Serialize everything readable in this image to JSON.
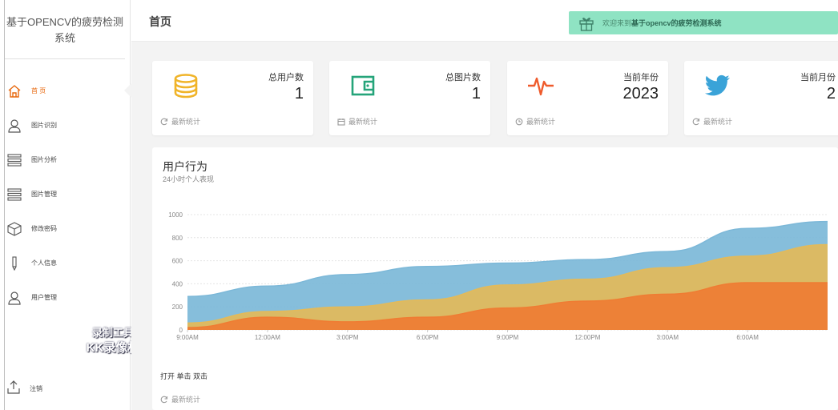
{
  "app": {
    "title": "基于OPENCV的疲劳检测系统"
  },
  "sidebar": {
    "items": [
      {
        "label": "首 页",
        "icon": "home-icon",
        "active": true
      },
      {
        "label": "图片识别",
        "icon": "user-icon"
      },
      {
        "label": "图片分析",
        "icon": "list-icon"
      },
      {
        "label": "图片管理",
        "icon": "list-icon"
      },
      {
        "label": "修改密码",
        "icon": "cube-icon"
      },
      {
        "label": "个人信息",
        "icon": "pen-icon"
      },
      {
        "label": "用户管理",
        "icon": "user-icon"
      }
    ],
    "logout_label": "注销"
  },
  "watermark": {
    "line1": "录制工具",
    "line2": "KK录像机"
  },
  "header": {
    "page_title": "首页",
    "welcome_prefix": "欢迎来到",
    "welcome_name": "基于opencv的疲劳检测系统"
  },
  "cards": [
    {
      "title": "总用户数",
      "value": "1",
      "footer": "最新统计",
      "icon": "database-icon",
      "footer_icon": "refresh-icon",
      "color": "#f0b429"
    },
    {
      "title": "总图片数",
      "value": "1",
      "footer": "最新统计",
      "icon": "wallet-icon",
      "footer_icon": "calendar-icon",
      "color": "#25a47a"
    },
    {
      "title": "当前年份",
      "value": "2023",
      "footer": "最新统计",
      "icon": "pulse-icon",
      "footer_icon": "clock-icon",
      "color": "#ef5b2c"
    },
    {
      "title": "当前月份",
      "value": "2",
      "footer": "最新统计",
      "icon": "twitter-icon",
      "footer_icon": "refresh-icon",
      "color": "#3aa3d8"
    }
  ],
  "panel": {
    "title": "用户行为",
    "subtitle": "24小时个人表现",
    "actions": "打开 单击 双击",
    "footer": "最新统计"
  },
  "chart_data": {
    "type": "area",
    "stacked": false,
    "x": [
      "9:00AM",
      "12:00AM",
      "3:00PM",
      "6:00PM",
      "9:00PM",
      "12:00PM",
      "3:00AM",
      "6:00AM",
      ""
    ],
    "ylim": [
      0,
      1000
    ],
    "yticks": [
      0,
      200,
      400,
      600,
      800,
      1000
    ],
    "grid": true,
    "series": [
      {
        "color": "#7cb8d8",
        "values": [
          290,
          380,
          480,
          550,
          580,
          610,
          680,
          880,
          940
        ]
      },
      {
        "color": "#e3ba5a",
        "values": [
          60,
          160,
          200,
          260,
          390,
          440,
          540,
          640,
          740
        ]
      },
      {
        "color": "#ef7c33",
        "values": [
          20,
          110,
          70,
          110,
          190,
          250,
          310,
          410,
          410
        ]
      }
    ]
  }
}
